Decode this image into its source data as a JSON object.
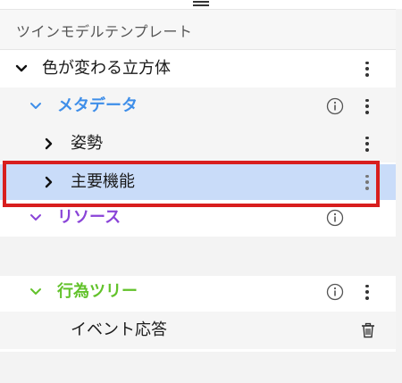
{
  "panel": {
    "title": "ツインモデルテンプレート"
  },
  "tree": {
    "root": {
      "label": "色が変わる立方体",
      "expanded": true
    },
    "metadata": {
      "label": "メタデータ",
      "expanded": true,
      "color": "#3e8ee9"
    },
    "pose": {
      "label": "姿勢",
      "expanded": false
    },
    "main_function": {
      "label": "主要機能",
      "expanded": false,
      "selected": true
    },
    "resources": {
      "label": "リソース",
      "expanded": true,
      "color": "#8a44d8"
    },
    "behavior_tree": {
      "label": "行為ツリー",
      "expanded": true,
      "color": "#62c22b"
    },
    "event_response": {
      "label": "イベント応答"
    }
  },
  "icons": {
    "expanded": "chevron-down-icon",
    "collapsed": "chevron-right-icon",
    "info": "info-icon",
    "more": "more-vertical-icon",
    "delete": "trash-icon",
    "drag": "drag-handle-icon"
  },
  "colors": {
    "selection_fill": "#c9dcf9",
    "selection_outline": "#d81e1e"
  }
}
